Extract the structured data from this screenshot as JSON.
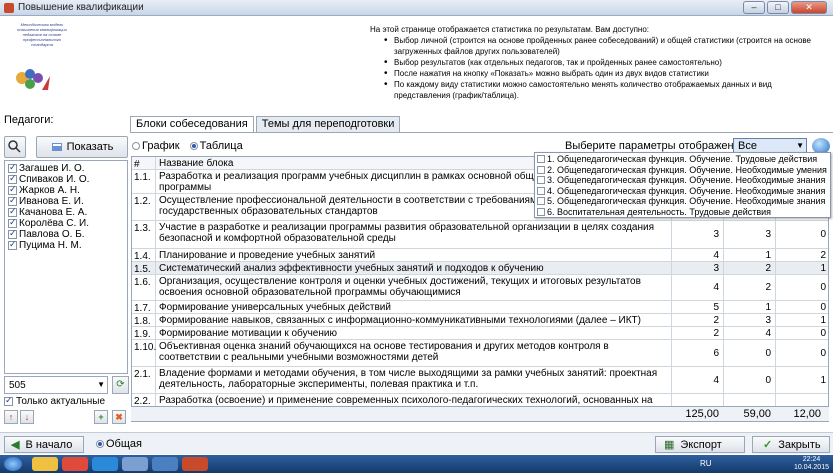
{
  "window": {
    "title": "Повышение квалификации"
  },
  "logo": {
    "text": "Методическая модель повышения квалификации педагогов на основе профессионального стандарта"
  },
  "info": {
    "intro": "На этой странице отображается статистика по результатам. Вам доступно:",
    "bullets": [
      "Выбор личной (строится на основе пройденных ранее собеседований) и общей статистики (строится на основе загруженных файлов других пользователей)",
      "Выбор результатов (как отдельных педагогов, так и пройденных ранее самостоятельно)",
      "После нажатия на кнопку «Показать» можно выбрать один из двух видов статистики",
      "По каждому виду статистики можно самостоятельно менять количество отображаемых данных и вид представления (график/таблица)."
    ]
  },
  "left": {
    "teachers_label": "Педагоги:",
    "show_button": "Показать",
    "teachers": [
      "Загашев И. О.",
      "Спиваков И. О.",
      "Жарков А. Н.",
      "Иванова Е. И.",
      "Качанова Е. А.",
      "Королёва С. И.",
      "Павлова О. Б.",
      "Пуцима Н. М."
    ],
    "combo_value": "505",
    "only_actual_label": "Только актуальные"
  },
  "tabs": [
    "Блоки собеседования",
    "Темы для переподготовки"
  ],
  "view_modes": {
    "chart": "График",
    "table": "Таблица"
  },
  "params": {
    "label": "Выберите параметры отображения :",
    "value": "Все",
    "options": [
      "1. Общепедагогическая функция. Обучение. Трудовые действия",
      "2. Общепедагогическая функция. Обучение. Необходимые умения",
      "3. Общепедагогическая функция. Обучение. Необходимые знания",
      "4. Общепедагогическая функция. Обучение. Необходимые знания",
      "5. Общепедагогическая функция. Обучение. Необходимые знания",
      "6. Воспитательная деятельность. Трудовые действия"
    ]
  },
  "table": {
    "headers": {
      "num": "#",
      "name": "Название блока"
    },
    "rows": [
      {
        "num": "1.1.",
        "name": "Разработка и реализация программ учебных дисциплин в рамках основной общеобразовательной программы",
        "v1": "",
        "v2": "",
        "v3": ""
      },
      {
        "num": "1.2.",
        "name": "Осуществление профессиональной деятельности в соответствии с требованиями федеральных государственных образовательных стандартов",
        "v1": "",
        "v2": "",
        "v3": ""
      },
      {
        "num": "1.3.",
        "name": "Участие в разработке и реализации программы развития образовательной организации в целях создания безопасной и комфортной образовательной среды",
        "v1": "3",
        "v2": "3",
        "v3": "0"
      },
      {
        "num": "1.4.",
        "name": "Планирование и проведение учебных занятий",
        "v1": "4",
        "v2": "1",
        "v3": "2"
      },
      {
        "num": "1.5.",
        "name": "Систематический анализ эффективности учебных занятий и подходов к обучению",
        "v1": "3",
        "v2": "2",
        "v3": "1"
      },
      {
        "num": "1.6.",
        "name": "Организация, осуществление контроля и оценки учебных достижений, текущих и итоговых результатов освоения основной образовательной программы обучающимися",
        "v1": "4",
        "v2": "2",
        "v3": "0"
      },
      {
        "num": "1.7.",
        "name": "Формирование универсальных учебных действий",
        "v1": "5",
        "v2": "1",
        "v3": "0"
      },
      {
        "num": "1.8.",
        "name": "Формирование навыков, связанных с информационно-коммуникативными технологиями (далее – ИКТ)",
        "v1": "2",
        "v2": "3",
        "v3": "1"
      },
      {
        "num": "1.9.",
        "name": "Формирование мотивации к обучению",
        "v1": "2",
        "v2": "4",
        "v3": "0"
      },
      {
        "num": "1.10.",
        "name": "Объективная оценка знаний обучающихся на основе тестирования и других методов контроля в соответствии с реальными учебными возможностями детей",
        "v1": "6",
        "v2": "0",
        "v3": "0"
      },
      {
        "num": "2.1.",
        "name": "Владение формами и методами обучения, в том числе выходящими за рамки учебных занятий: проектная деятельность, лабораторные эксперименты, полевая практика и т.п.",
        "v1": "4",
        "v2": "0",
        "v3": "1"
      },
      {
        "num": "2.2.",
        "name": "Разработка (освоение) и применение современных психолого-педагогических технологий, основанных на",
        "v1": "",
        "v2": "",
        "v3": ""
      }
    ],
    "totals": {
      "v1": "125,00",
      "v2": "59,00",
      "v3": "12,00"
    }
  },
  "bottom": {
    "start_button": "В начало",
    "general_label": "Общая",
    "export_button": "Экспорт",
    "close_button": "Закрыть"
  },
  "taskbar": {
    "lang": "RU",
    "time": "22:24",
    "date": "10.04.2015"
  }
}
